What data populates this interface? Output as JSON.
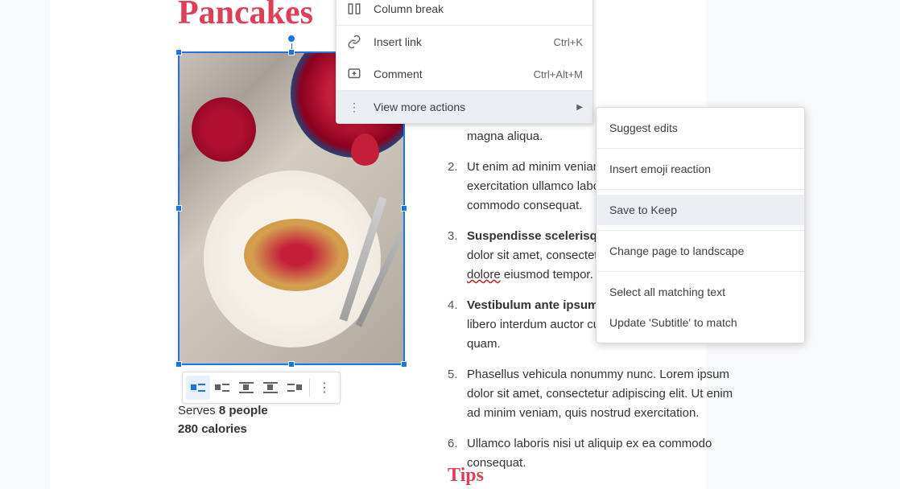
{
  "title": "Pancakes",
  "meta": {
    "serves_label": "Serves",
    "serves_value": "8 people",
    "calories": "280 calories"
  },
  "list": {
    "magna": "magna aliqua.",
    "i2": "Ut enim ad minim veniam, quis nostrud exercitation ullamco laboris nisi ut aliquip ex ea commodo consequat.",
    "i3a": "Suspendisse scelerisque mi a mi.",
    "i3b": " Lorem ipsum dolor sit amet, consectetur adipiscing elit, sed ",
    "i3c": "dolore",
    "i3d": " eiusmod tempor.",
    "i4a": "Vestibulum ante ipsum primis elementum",
    "i4b": ", libero interdum auctor cursus, sapien enim dictum quam.",
    "i5": "Phasellus vehicula nonummy nunc. Lorem ipsum dolor sit amet, consectetur adipiscing elit. Ut enim ad minim veniam, quis nostrud exercitation.",
    "i6": "Ullamco laboris nisi ut aliquip ex ea commodo consequat."
  },
  "tips": "Tips",
  "context_menu": {
    "column_break": "Column break",
    "insert_link": "Insert link",
    "insert_link_shortcut": "Ctrl+K",
    "comment": "Comment",
    "comment_shortcut": "Ctrl+Alt+M",
    "view_more": "View more actions"
  },
  "sub_menu": {
    "suggest": "Suggest edits",
    "emoji": "Insert emoji reaction",
    "keep": "Save to Keep",
    "landscape": "Change page to landscape",
    "select_matching": "Select all matching text",
    "update_subtitle": "Update 'Subtitle' to match"
  }
}
